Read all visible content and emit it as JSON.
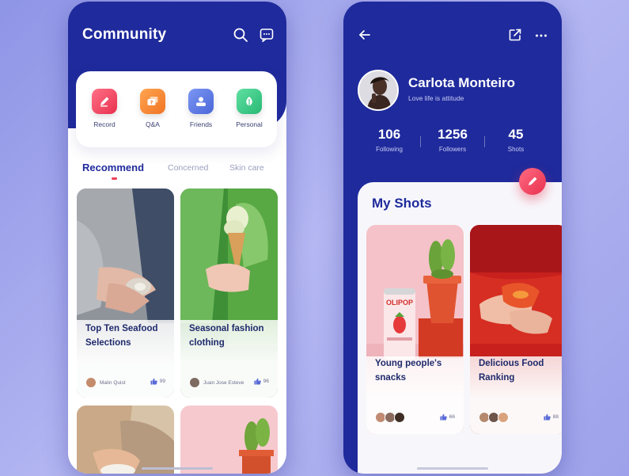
{
  "community": {
    "title": "Community",
    "categories": [
      {
        "label": "Record",
        "icon": "pencil-icon",
        "color": "#f0506a"
      },
      {
        "label": "Q&A",
        "icon": "chat-question-icon",
        "color": "#f5893a"
      },
      {
        "label": "Friends",
        "icon": "user-card-icon",
        "color": "#5a7ae8"
      },
      {
        "label": "Personal",
        "icon": "leaf-icon",
        "color": "#3fcf8e"
      }
    ],
    "tabs": [
      {
        "label": "Recommend",
        "active": true
      },
      {
        "label": "Concerned",
        "active": false
      },
      {
        "label": "Skin care",
        "active": false
      }
    ],
    "posts": [
      {
        "title": "Top Ten Seafood Selections",
        "author": "Malin Quist",
        "likes": "99"
      },
      {
        "title": "Seasonal fashion clothing",
        "author": "Juan Jose Esteve",
        "likes": "96"
      }
    ]
  },
  "profile": {
    "name": "Carlota Monteiro",
    "bio": "Love life is attitude",
    "stats": [
      {
        "value": "106",
        "label": "Following"
      },
      {
        "value": "1256",
        "label": "Followers"
      },
      {
        "value": "45",
        "label": "Shots"
      }
    ],
    "section_title": "My Shots",
    "shots": [
      {
        "title": "Young people's snacks",
        "likes": "66"
      },
      {
        "title": "Delicious Food Ranking",
        "likes": "88"
      }
    ],
    "can_label": "OLIPOP"
  },
  "colors": {
    "primary": "#1f2a9c",
    "accent": "#ee3f5a"
  }
}
